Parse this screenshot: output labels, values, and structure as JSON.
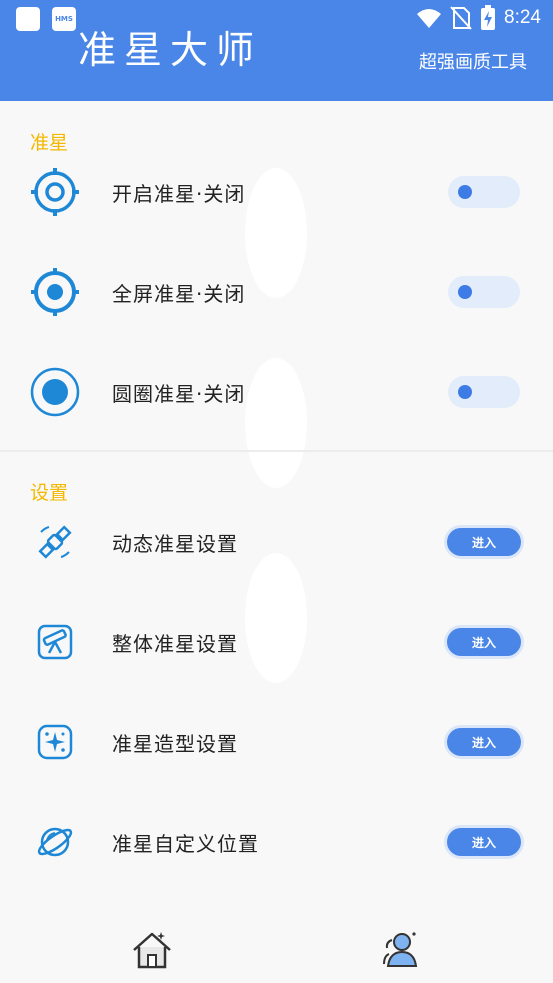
{
  "status_bar": {
    "time": "8:24",
    "hms_label": "HMS"
  },
  "header": {
    "title": "准星大师",
    "subtitle": "超强画质工具"
  },
  "sections": {
    "crosshair": {
      "label": "准星"
    },
    "settings": {
      "label": "设置"
    }
  },
  "toggles": [
    {
      "label": "开启准星·关闭",
      "icon": "crosshair-target-icon",
      "on": false
    },
    {
      "label": "全屏准星·关闭",
      "icon": "crosshair-filled-icon",
      "on": false
    },
    {
      "label": "圆圈准星·关闭",
      "icon": "circle-dot-icon",
      "on": false
    }
  ],
  "setting_items": [
    {
      "label": "动态准星设置",
      "icon": "satellite-icon",
      "button": "进入"
    },
    {
      "label": "整体准星设置",
      "icon": "telescope-icon",
      "button": "进入"
    },
    {
      "label": "准星造型设置",
      "icon": "sparkle-icon",
      "button": "进入"
    },
    {
      "label": "准星自定义位置",
      "icon": "planet-icon",
      "button": "进入"
    }
  ],
  "bottom_nav": [
    {
      "icon": "home-icon"
    },
    {
      "icon": "user-group-icon"
    }
  ],
  "colors": {
    "primary": "#4a86e8",
    "section": "#f5b800",
    "icon": "#1e88d6"
  }
}
